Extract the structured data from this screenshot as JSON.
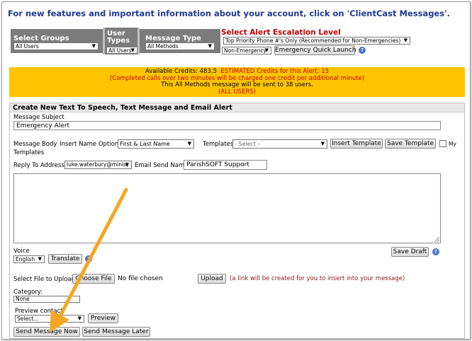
{
  "header": {
    "text": "For new features and important information about your account, click on 'ClientCast Messages'."
  },
  "filters": {
    "groups_label": "Select Groups",
    "groups_value": "All Users",
    "user_types_label": "User Types",
    "user_types_value": "All Users",
    "message_type_label": "Message Type",
    "message_type_value": "All Methods"
  },
  "escalation": {
    "title": "Select Alert Escalation Level",
    "priority_value": "Top Priority Phone #'s Only (Recommended for Non-Emergencies)",
    "level_value": "Non-Emergency",
    "quick_launch_label": "Emergency Quick Launch",
    "help_icon": "?"
  },
  "credits": {
    "available_label": "Available Credits: ",
    "available_value": "483.5",
    "estimated_label": "ESTIMATED Credits for this Alert: ",
    "estimated_value": "15",
    "charge_note": "(Completed calls over two minutes will be charged one credit per additional minute)",
    "sent_note": "This All Methods message will be sent to 38 users.",
    "audience": "(ALL USERS)"
  },
  "panel": {
    "title": "Create New Text To Speech, Text Message and Email Alert",
    "subject_label": "Message Subject",
    "subject_value": "Emergency Alert",
    "body_label": "Message Body",
    "insert_name_label": "Insert Name Options:",
    "insert_name_value": "First & Last Name",
    "templates_label": "Templates:",
    "templates_value": "- Select -",
    "insert_template_label": "Insert Template",
    "save_template_label": "Save Template",
    "my_label": "My",
    "templates_suffix": "Templates",
    "reply_label": "Reply To Address:",
    "reply_value": "luke.waterbury@minist",
    "email_send_name_label": "Email Send Name:",
    "email_send_name_value": "ParishSOFT Support",
    "voice_label": "Voice",
    "voice_value": "English",
    "translate_label": "Translate",
    "save_draft_label": "Save Draft",
    "file_label": "Select File to Upload",
    "choose_file_label": "Choose File",
    "no_file_text": "No file chosen",
    "upload_label": "Upload",
    "upload_note": "(a link will be created for you to insert into your message)",
    "category_label": "Category:",
    "category_value": "None",
    "preview_contact_label": "Preview contact:",
    "preview_contact_value": "Select...",
    "preview_label": "Preview",
    "send_now_label": "Send Message Now",
    "send_later_label": "Send Message Later"
  },
  "colors": {
    "header_blue": "#1f3a93",
    "filter_bar": "#7c7c7c",
    "credits_bg": "#ffc400",
    "alert_red": "#c00000",
    "annotation_arrow": "#f5a623"
  }
}
